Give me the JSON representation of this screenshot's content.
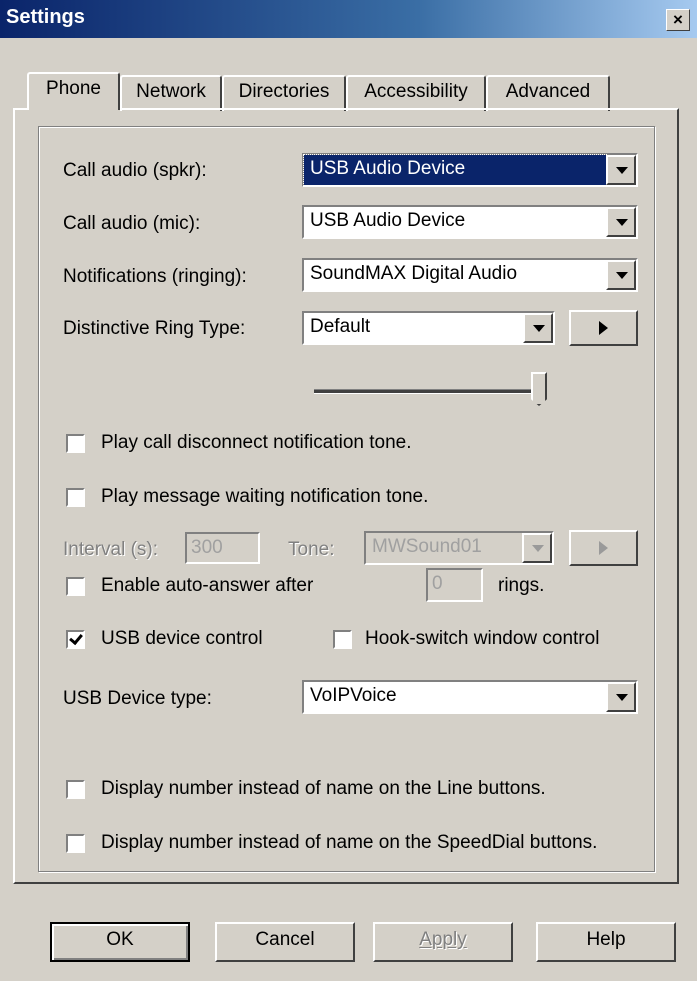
{
  "window": {
    "title": "Settings",
    "close_glyph": "×"
  },
  "tabs": [
    {
      "label": "Phone",
      "selected": true
    },
    {
      "label": "Network",
      "selected": false
    },
    {
      "label": "Directories",
      "selected": false
    },
    {
      "label": "Accessibility",
      "selected": false
    },
    {
      "label": "Advanced",
      "selected": false
    }
  ],
  "phone": {
    "call_audio_spkr": {
      "label": "Call audio (spkr):",
      "value": "USB Audio Device"
    },
    "call_audio_mic": {
      "label": "Call audio (mic):",
      "value": "USB Audio Device"
    },
    "notifications": {
      "label": "Notifications (ringing):",
      "value": "SoundMAX Digital Audio"
    },
    "ring_type": {
      "label": "Distinctive Ring Type:",
      "value": "Default"
    },
    "volume_level": 1.0,
    "play_disconnect": {
      "label": "Play call disconnect notification tone.",
      "checked": false
    },
    "play_message_waiting": {
      "label": "Play message waiting notification tone.",
      "checked": false
    },
    "interval": {
      "label": "Interval (s):",
      "value": "300"
    },
    "tone": {
      "label": "Tone:",
      "value": "MWSound01"
    },
    "auto_answer": {
      "label": "Enable auto-answer after",
      "value": "0",
      "suffix": "rings."
    },
    "usb_device_control": {
      "label": "USB device control",
      "checked": true
    },
    "hook_switch": {
      "label": "Hook-switch window control",
      "checked": false
    },
    "usb_device_type": {
      "label": "USB Device type:",
      "value": "VoIPVoice"
    },
    "display_number_line": {
      "label": "Display number instead of name on the Line buttons.",
      "checked": false
    },
    "display_number_speeddial": {
      "label": "Display number instead of name on the SpeedDial buttons.",
      "checked": false
    }
  },
  "buttons": {
    "ok": "OK",
    "cancel": "Cancel",
    "apply": "Apply",
    "help": "Help"
  },
  "icons": {
    "play": "play-icon",
    "dropdown": "chevron-down-icon"
  },
  "colors": {
    "titlebar_start": "#0a246a",
    "titlebar_end": "#a6caf0",
    "face": "#d4d0c8",
    "selection": "#0a246a"
  }
}
